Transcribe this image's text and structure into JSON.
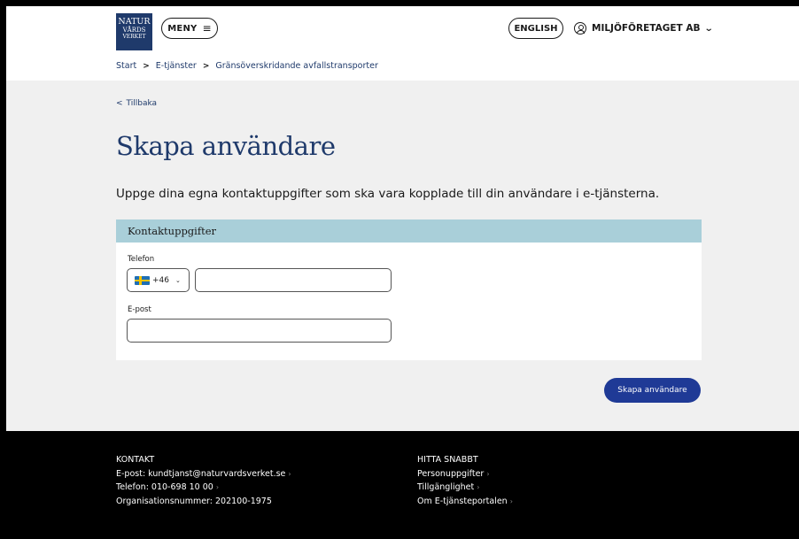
{
  "header": {
    "logo": {
      "line1": "NATUR",
      "line2": "VÅRDS",
      "line3": "VERKET"
    },
    "menu_label": "MENY",
    "menu_icon": "hamburger-icon",
    "language_label": "ENGLISH",
    "account_label": "MILJÖFÖRETAGET AB",
    "account_icon": "user-circle-icon"
  },
  "breadcrumb": {
    "items": [
      "Start",
      "E-tjänster",
      "Gränsöverskridande avfallstransporter"
    ],
    "separator": ">"
  },
  "main": {
    "back_label": "Tillbaka",
    "back_glyph": "<",
    "title": "Skapa användare",
    "intro": "Uppge dina egna kontaktuppgifter som ska vara kopplade till din användare i e-tjänsterna.",
    "card": {
      "heading": "Kontaktuppgifter",
      "phone_label": "Telefon",
      "country_code": "+46",
      "phone_value": "",
      "email_label": "E-post",
      "email_value": ""
    },
    "submit_label": "Skapa användare"
  },
  "footer": {
    "contact": {
      "heading": "KONTAKT",
      "email": "E-post: kundtjanst@naturvardsverket.se",
      "phone": "Telefon: 010-698 10 00",
      "org": "Organisationsnummer: 202100-1975"
    },
    "quick": {
      "heading": "HITTA SNABBT",
      "links": [
        "Personuppgifter",
        "Tillgänglighet",
        "Om E-tjänsteportalen"
      ]
    }
  },
  "colors": {
    "brand_navy": "#1f3a6b",
    "card_header": "#a9cfd9",
    "button": "#1f3a96",
    "page_bg": "#f0f0f0"
  }
}
